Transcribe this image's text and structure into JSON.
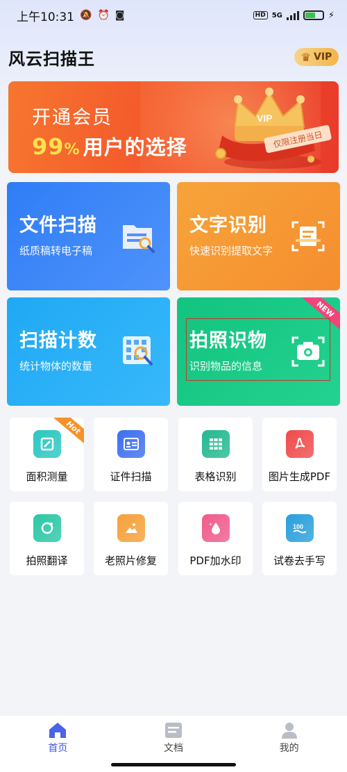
{
  "status_bar": {
    "time": "上午10:31",
    "network": "5G"
  },
  "header": {
    "app_title": "风云扫描王",
    "vip_label": "VIP"
  },
  "banner": {
    "line1": "开通会员",
    "percent_number": "99",
    "percent_symbol": "%",
    "line2_text": "用户的选择",
    "crown_text": "VIP",
    "tag_text": "仅限注册当日"
  },
  "tiles": [
    {
      "title": "文件扫描",
      "subtitle": "纸质稿转电子稿",
      "icon": "document-scan-icon"
    },
    {
      "title": "文字识别",
      "subtitle": "快速识别提取文字",
      "icon": "text-recognition-icon"
    },
    {
      "title": "扫描计数",
      "subtitle": "统计物体的数量",
      "icon": "count-scan-icon"
    },
    {
      "title": "拍照识物",
      "subtitle": "识别物品的信息",
      "icon": "camera-identify-icon",
      "badge": "NEW"
    }
  ],
  "grid": [
    {
      "label": "面积测量",
      "icon": "area-measure-icon",
      "badge": "Hot",
      "color": "#2bc7c0"
    },
    {
      "label": "证件扫描",
      "icon": "id-card-icon",
      "color": "#3d6ff0"
    },
    {
      "label": "表格识别",
      "icon": "table-icon",
      "color": "#23b98f"
    },
    {
      "label": "图片生成PDF",
      "icon": "pdf-icon",
      "color": "#ef4b4b"
    },
    {
      "label": "拍照翻译",
      "icon": "translate-camera-icon",
      "color": "#2bc7a6"
    },
    {
      "label": "老照片修复",
      "icon": "photo-restore-icon",
      "color": "#f5a13a"
    },
    {
      "label": "PDF加水印",
      "icon": "watermark-icon",
      "color": "#f05b8a"
    },
    {
      "label": "试卷去手写",
      "icon": "exam-clean-icon",
      "color": "#2a9fdc"
    }
  ],
  "bottom_nav": [
    {
      "label": "首页",
      "icon": "home-icon",
      "active": true
    },
    {
      "label": "文档",
      "icon": "document-icon",
      "active": false
    },
    {
      "label": "我的",
      "icon": "profile-icon",
      "active": false
    }
  ],
  "colors": {
    "accent": "#3b58e0",
    "banner": "#f2512b",
    "percent_highlight": "#ffe34f"
  }
}
